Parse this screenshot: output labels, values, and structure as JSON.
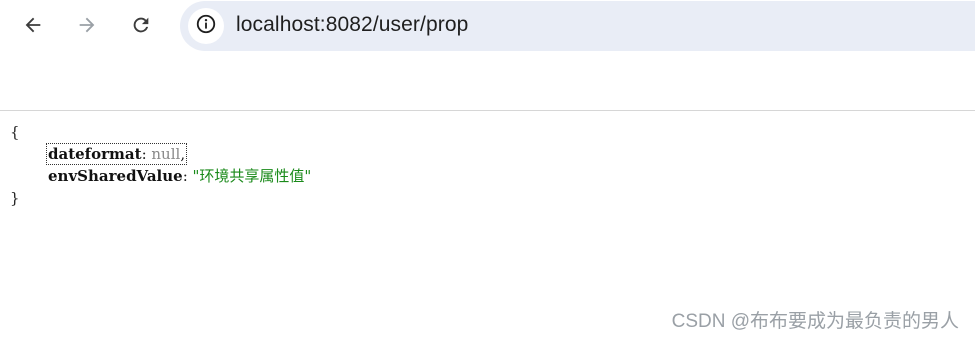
{
  "browser": {
    "url": "localhost:8082/user/prop",
    "icons": {
      "back": "arrow-left-icon",
      "forward": "arrow-right-icon",
      "reload": "reload-icon",
      "site_info": "info-circle-icon"
    }
  },
  "json_view": {
    "open_brace": "{",
    "close_brace": "}",
    "entries": [
      {
        "key": "dateformat",
        "separator": ": ",
        "value": "null",
        "trailing": ","
      },
      {
        "key": "envSharedValue",
        "separator": ": ",
        "value": "\"环境共享属性值\"",
        "trailing": ""
      }
    ]
  },
  "watermark": "CSDN @布布要成为最负责的男人",
  "colors": {
    "omnibox_bg": "#e9edf6",
    "json_string": "#1a8a1a",
    "json_null": "#8a8a8a"
  }
}
